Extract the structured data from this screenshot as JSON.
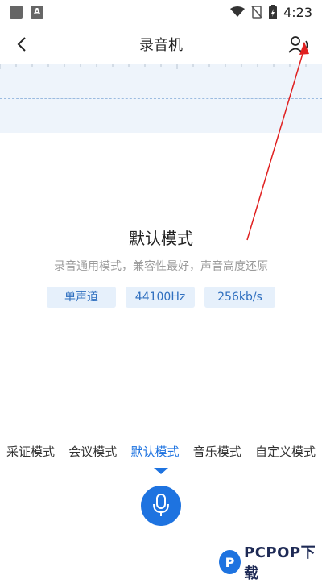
{
  "status_bar": {
    "time": "4:23",
    "icons": [
      "notification-square-icon",
      "a-badge-icon",
      "wifi-icon",
      "no-sim-icon",
      "battery-charging-icon"
    ]
  },
  "header": {
    "title": "录音机",
    "back_icon": "chevron-left-icon",
    "action_icon": "user-voice-icon"
  },
  "mode_info": {
    "title": "默认模式",
    "description": "录音通用模式，兼容性最好，声音高度还原",
    "tags": [
      "单声道",
      "44100Hz",
      "256kb/s"
    ]
  },
  "modes": {
    "items": [
      "采证模式",
      "会议模式",
      "默认模式",
      "音乐模式",
      "自定义模式"
    ],
    "active_index": 2
  },
  "record_button": {
    "icon": "microphone-icon"
  },
  "watermark": {
    "text": "PCPOP下载",
    "logo_letter": "P"
  },
  "colors": {
    "accent": "#1e73e0",
    "wave_bg": "#eef4fb",
    "annotation": "#e02020"
  }
}
